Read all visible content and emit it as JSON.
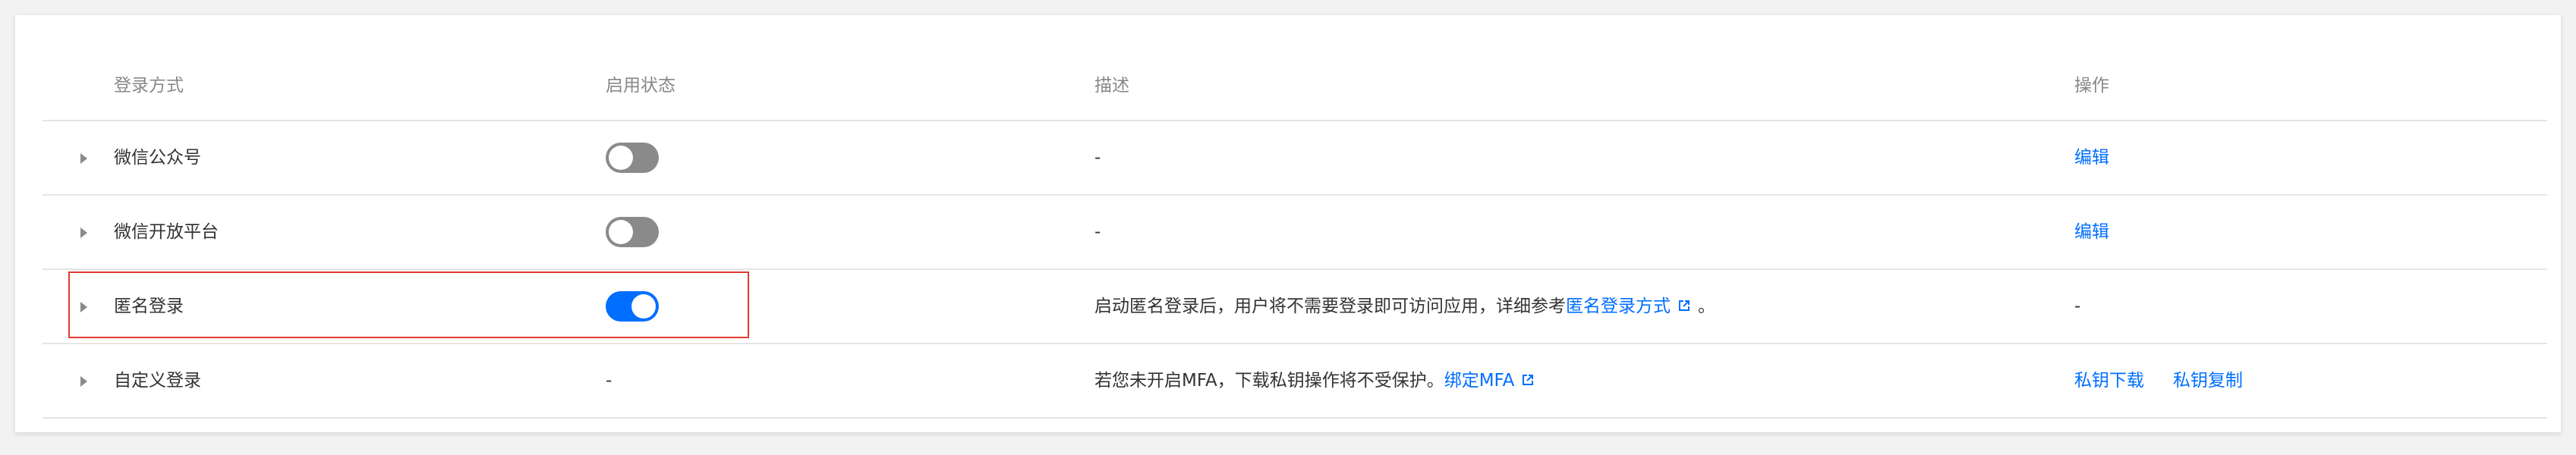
{
  "table": {
    "headers": {
      "method": "登录方式",
      "status": "启用状态",
      "description": "描述",
      "actions": "操作"
    },
    "rows": [
      {
        "name": "微信公众号",
        "toggle_on": false,
        "description": "-",
        "action": "编辑"
      },
      {
        "name": "微信开放平台",
        "toggle_on": false,
        "description": "-",
        "action": "编辑"
      },
      {
        "name": "匿名登录",
        "toggle_on": true,
        "description_prefix": "启动匿名登录后，用户将不需要登录即可访问应用，详细参考",
        "description_link": "匿名登录方式",
        "description_suffix": "。",
        "action_text": "-"
      },
      {
        "name": "自定义登录",
        "status_text": "-",
        "description_prefix": "若您未开启MFA，下载私钥操作将不受保护。",
        "description_link": "绑定MFA",
        "actions": [
          "私钥下载",
          "私钥复制"
        ]
      }
    ]
  },
  "colors": {
    "link": "#006eff",
    "toggle_on": "#006eff",
    "toggle_off": "#8a8a8a",
    "highlight": "#e23a2e"
  }
}
